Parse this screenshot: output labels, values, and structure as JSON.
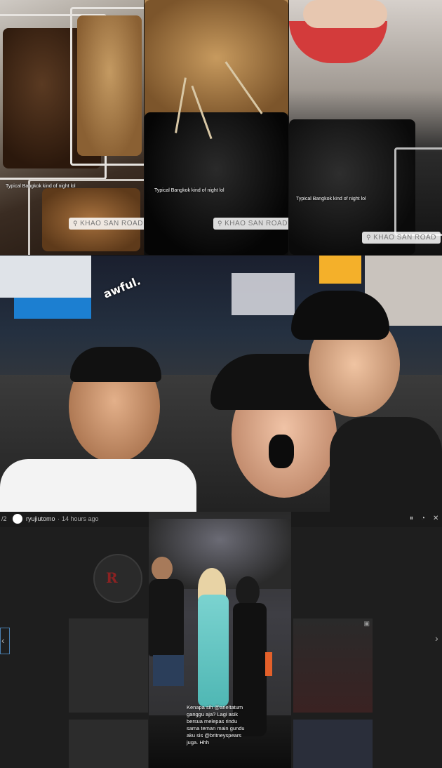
{
  "top_strip": {
    "panels": [
      {
        "caption": "Typical Bangkok kind of night lol",
        "location": "KHAO SAN ROAD"
      },
      {
        "caption": "Typical Bangkok kind of night lol",
        "location": "KHAO SAN ROAD"
      },
      {
        "caption": "Typical Bangkok kind of night lol",
        "location": "KHAO SAN ROAD"
      }
    ]
  },
  "selfie": {
    "sticker_text": "awful."
  },
  "viewer": {
    "counter": "/2",
    "username": "ryujiutomo",
    "timestamp": "14 hours ago",
    "story_caption": "Kenapa sih @arieltatum ganggu aja? Lagi asik bersua melepas rindu sama teman main gundu aku sis @britneyspears juga. Hhh",
    "icons": [
      "pause-icon",
      "mute-icon",
      "close-icon",
      "previous-arrow-icon",
      "next-arrow-icon",
      "video-icon"
    ]
  }
}
